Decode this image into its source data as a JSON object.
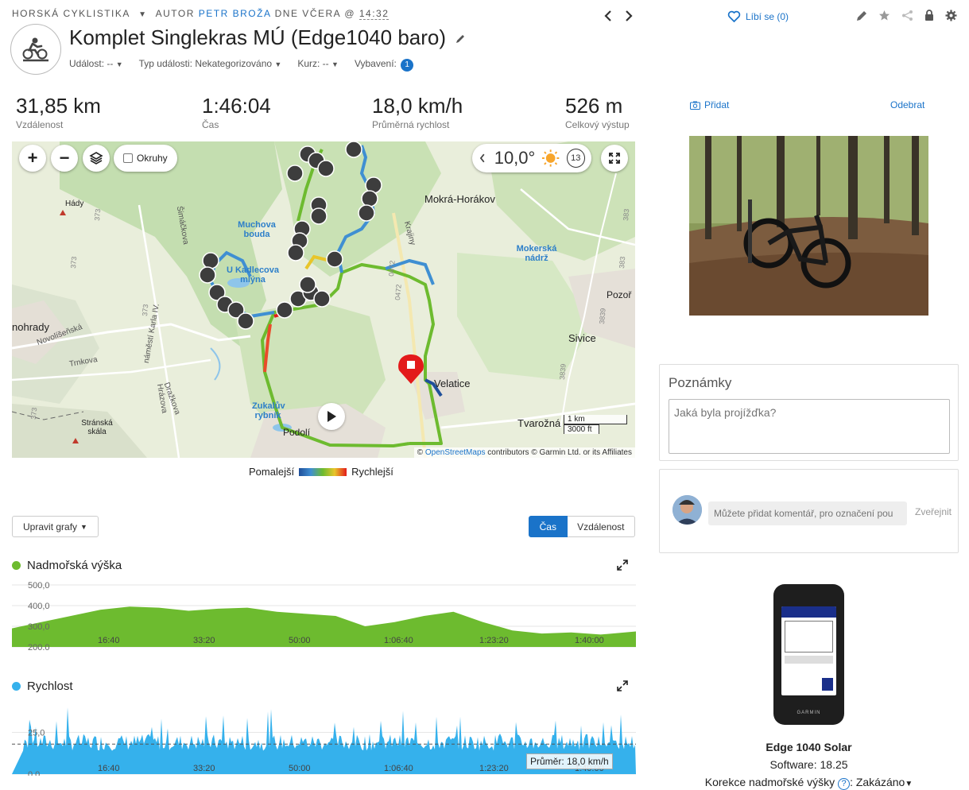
{
  "header": {
    "activity_type": "HORSKÁ CYKLISTIKA",
    "author_prefix": "AUTOR",
    "author_name": "PETR BROŽA",
    "when": "DNE VČERA @",
    "time": "14:32",
    "title": "Komplet Singlekras MÚ (Edge1040 baro)",
    "meta": {
      "event_label": "Událost: --",
      "event_type_label": "Typ události: Nekategorizováno",
      "course_label": "Kurz: --",
      "gear_label": "Vybavení:",
      "gear_count": "1"
    },
    "like_label": "Líbí se (0)"
  },
  "stats": [
    {
      "value": "31,85 km",
      "label": "Vzdálenost"
    },
    {
      "value": "1:46:04",
      "label": "Čas"
    },
    {
      "value": "18,0 km/h",
      "label": "Průměrná rychlost"
    },
    {
      "value": "526 m",
      "label": "Celkový výstup"
    }
  ],
  "map": {
    "laps_label": "Okruhy",
    "temperature": "10,0°",
    "wind_value": "13",
    "places": {
      "hady": "Hády",
      "mokra": "Mokrá-Horákov",
      "muchova": "Muchova bouda",
      "kadlecova": "U Kadlecova mlýna",
      "mokerska": "Mokerská nádrž",
      "pozor": "Pozoř",
      "sivice": "Sivice",
      "hrady": "nohrady",
      "velatice": "Velatice",
      "tvarozna": "Tvarožná",
      "pozori": "Podolí",
      "stranska": "Stránská skála",
      "zukal": "Zukalův rybník",
      "novolis": "Novolíšeňská",
      "trnkova": "Trnkova",
      "hrazova": "Hrázova",
      "drazkova": "Dražkova",
      "karla": "náměstí Karla IV.",
      "simackova": "Šimáčkova",
      "krajiny": "Krajiny"
    },
    "scale_km": "1 km",
    "scale_ft": "3000 ft",
    "attribution_link": "OpenStreetMaps",
    "attribution_rest": "contributors © Garmin Ltd. or its Affiliates",
    "legend_slow": "Pomalejší",
    "legend_fast": "Rychlejší"
  },
  "controls": {
    "edit_charts": "Upravit grafy",
    "toggle_time": "Čas",
    "toggle_distance": "Vzdálenost"
  },
  "charts": {
    "elevation": {
      "title": "Nadmořská výška",
      "color": "#6dbb2f",
      "y_ticks": [
        "500,0",
        "400,0",
        "300,0",
        "200,0"
      ],
      "x_ticks": [
        "16:40",
        "33:20",
        "50:00",
        "1:06:40",
        "1:23:20",
        "1:40:00"
      ]
    },
    "speed": {
      "title": "Rychlost",
      "color": "#35b1ec",
      "y_ticks": [
        "25,0",
        "0,0"
      ],
      "x_ticks": [
        "16:40",
        "33:20",
        "50:00",
        "1:06:40",
        "1:23:20",
        "1:40:00"
      ],
      "avg_label": "Průměr: 18,0 km/h"
    }
  },
  "chart_data": [
    {
      "type": "area",
      "title": "Nadmořská výška",
      "ylim": [
        200,
        500
      ],
      "x_ticks": [
        "16:40",
        "33:20",
        "50:00",
        "1:06:40",
        "1:23:20",
        "1:40:00"
      ],
      "x_minutes": [
        0,
        5,
        10,
        15,
        20,
        25,
        30,
        35,
        40,
        45,
        50,
        55,
        60,
        65,
        70,
        75,
        80,
        85,
        90,
        95,
        100,
        106
      ],
      "values": [
        290,
        320,
        350,
        380,
        395,
        390,
        375,
        385,
        390,
        370,
        360,
        350,
        300,
        320,
        350,
        370,
        320,
        280,
        265,
        270,
        260,
        275
      ]
    },
    {
      "type": "area",
      "title": "Rychlost",
      "ylim": [
        0,
        40
      ],
      "x_ticks": [
        "16:40",
        "33:20",
        "50:00",
        "1:06:40",
        "1:23:20",
        "1:40:00"
      ],
      "average": 18.0
    }
  ],
  "sidebar": {
    "add_label": "Přidat",
    "remove_label": "Odebrat",
    "notes_title": "Poznámky",
    "notes_placeholder": "Jaká byla projížďka?",
    "comment_placeholder": "Můžete přidat komentář, pro označení pou",
    "publish_label": "Zveřejnit",
    "device_name": "Edge 1040 Solar",
    "software": "Software: 18.25",
    "elev_correction_label": "Korekce nadmořské výšky",
    "elev_correction_value": ": Zakázáno"
  }
}
